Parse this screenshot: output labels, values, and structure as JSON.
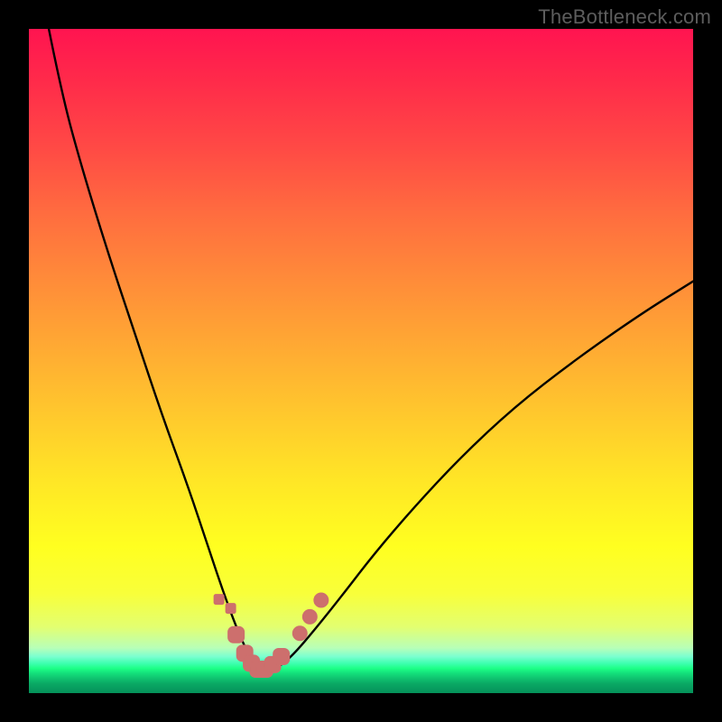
{
  "watermark": "TheBottleneck.com",
  "colors": {
    "frame": "#000000",
    "curve_stroke": "#000000",
    "marker_fill": "#cd6f6d",
    "marker_stroke": "#cd6f6d"
  },
  "chart_data": {
    "type": "line",
    "title": "",
    "xlabel": "",
    "ylabel": "",
    "xlim": [
      0,
      100
    ],
    "ylim": [
      0,
      100
    ],
    "grid": false,
    "series": [
      {
        "name": "bottleneck-curve",
        "x": [
          3,
          5,
          8,
          12,
          16,
          20,
          24,
          27,
          29,
          31,
          32.5,
          33.5,
          34.5,
          35.5,
          36.5,
          38,
          40,
          43,
          47,
          52,
          58,
          65,
          73,
          82,
          92,
          100
        ],
        "y": [
          100,
          90,
          79,
          66,
          54,
          42,
          31,
          22,
          16,
          10.5,
          7,
          5,
          3.8,
          3.3,
          3.5,
          4.2,
          6,
          9.5,
          14.5,
          21,
          28,
          35.5,
          43,
          50,
          57,
          62
        ]
      }
    ],
    "markers": [
      {
        "shape": "square-pair",
        "x": 29.5,
        "y": 13.5
      },
      {
        "shape": "rounded",
        "x": 31.2,
        "y": 8.8
      },
      {
        "shape": "rounded",
        "x": 32.5,
        "y": 6.0
      },
      {
        "shape": "rounded",
        "x": 33.5,
        "y": 4.5
      },
      {
        "shape": "rounded",
        "x": 34.5,
        "y": 3.6
      },
      {
        "shape": "rounded",
        "x": 35.5,
        "y": 3.6
      },
      {
        "shape": "rounded",
        "x": 36.7,
        "y": 4.3
      },
      {
        "shape": "rounded",
        "x": 38.0,
        "y": 5.5
      },
      {
        "shape": "circle",
        "x": 40.8,
        "y": 9.0
      },
      {
        "shape": "circle",
        "x": 42.3,
        "y": 11.5
      },
      {
        "shape": "circle",
        "x": 44.0,
        "y": 14.0
      }
    ],
    "gradient_bands": [
      {
        "label": "red-top",
        "y_start": 100,
        "y_end": 22
      },
      {
        "label": "yellow-mid",
        "y_start": 22,
        "y_end": 6.8
      },
      {
        "label": "green-foot",
        "y_start": 6.8,
        "y_end": 0
      }
    ]
  }
}
